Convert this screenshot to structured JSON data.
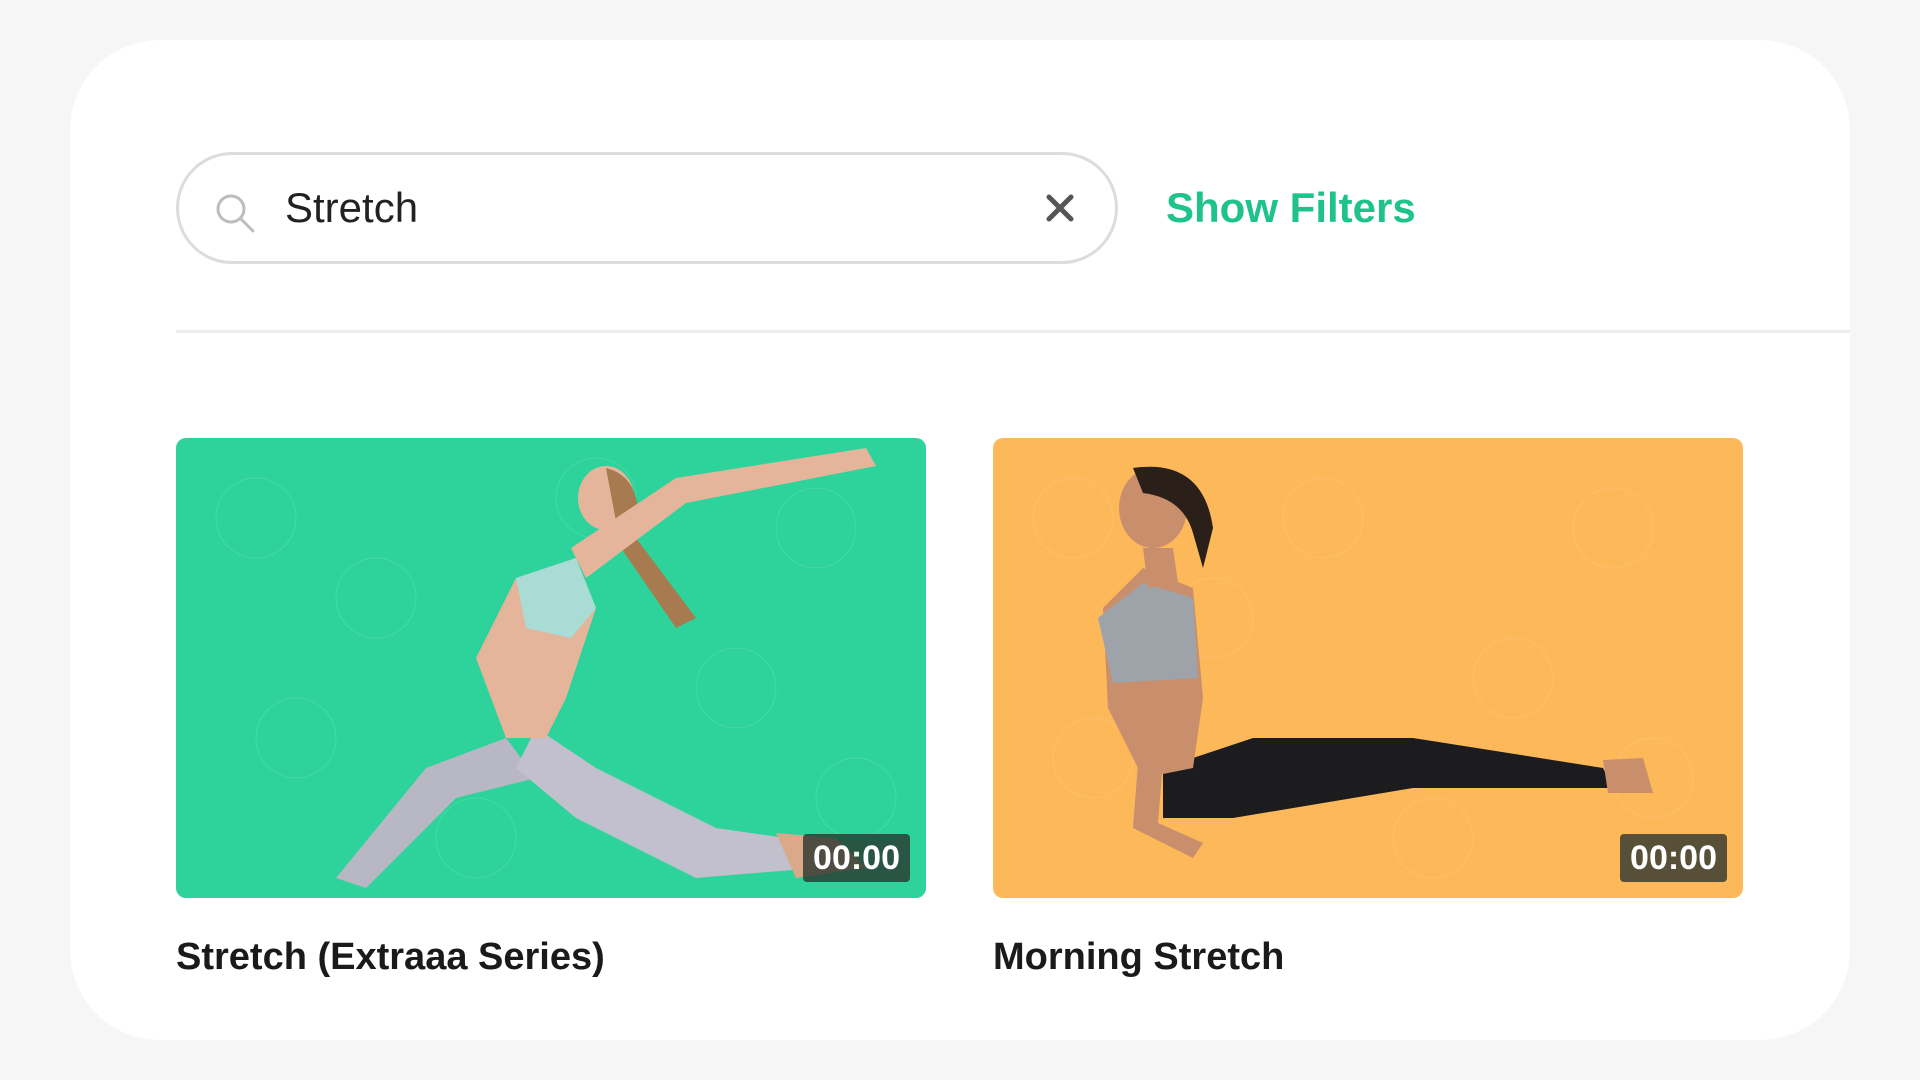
{
  "search": {
    "value": "Stretch",
    "icon": "search-icon",
    "clear_icon": "close-icon"
  },
  "filters": {
    "label": "Show Filters",
    "color": "#1fc38a"
  },
  "videos": [
    {
      "title": "Stretch (Extraaa Series)",
      "duration": "00:00",
      "bg_color": "#2dd39a"
    },
    {
      "title": "Morning Stretch",
      "duration": "00:00",
      "bg_color": "#fdb85a"
    }
  ]
}
